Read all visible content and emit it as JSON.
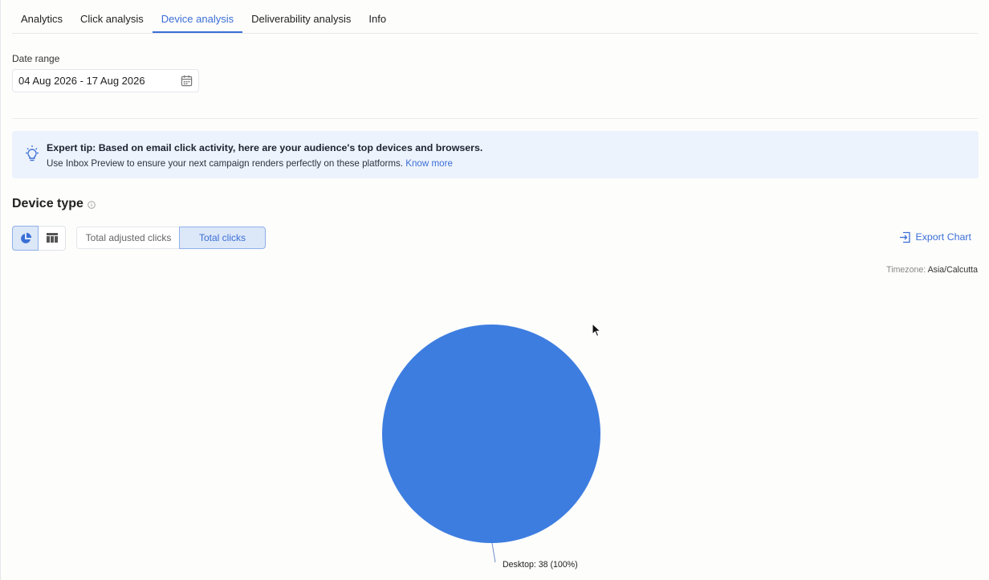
{
  "tabs": [
    {
      "label": "Analytics",
      "active": false
    },
    {
      "label": "Click analysis",
      "active": false
    },
    {
      "label": "Device analysis",
      "active": true
    },
    {
      "label": "Deliverability analysis",
      "active": false
    },
    {
      "label": "Info",
      "active": false
    }
  ],
  "date_range": {
    "label": "Date range",
    "value": "04 Aug 2026 - 17 Aug 2026",
    "icon": "calendar-icon"
  },
  "tip": {
    "icon": "lightbulb-icon",
    "headline": "Expert tip: Based on email click activity, here are your audience's top devices and browsers.",
    "body": "Use Inbox Preview to ensure your next campaign renders perfectly on these platforms.",
    "link": "Know more"
  },
  "device_type": {
    "title": "Device type",
    "view_modes": [
      {
        "name": "pie-chart-icon",
        "active": true
      },
      {
        "name": "table-icon",
        "active": false
      }
    ],
    "metric_options": [
      {
        "label": "Total adjusted clicks",
        "active": false
      },
      {
        "label": "Total clicks",
        "active": true
      }
    ],
    "export_label": "Export Chart",
    "timezone_label": "Timezone:",
    "timezone_value": "Asia/Calcutta"
  },
  "colors": {
    "accent": "#3b6fd6",
    "slice": "#3d7de0",
    "tip_bg": "#edf3fc"
  },
  "chart_data": {
    "type": "pie",
    "slices": [
      {
        "label": "Desktop",
        "value": 38,
        "percent": 100,
        "display": "Desktop: 38 (100%)"
      }
    ]
  }
}
